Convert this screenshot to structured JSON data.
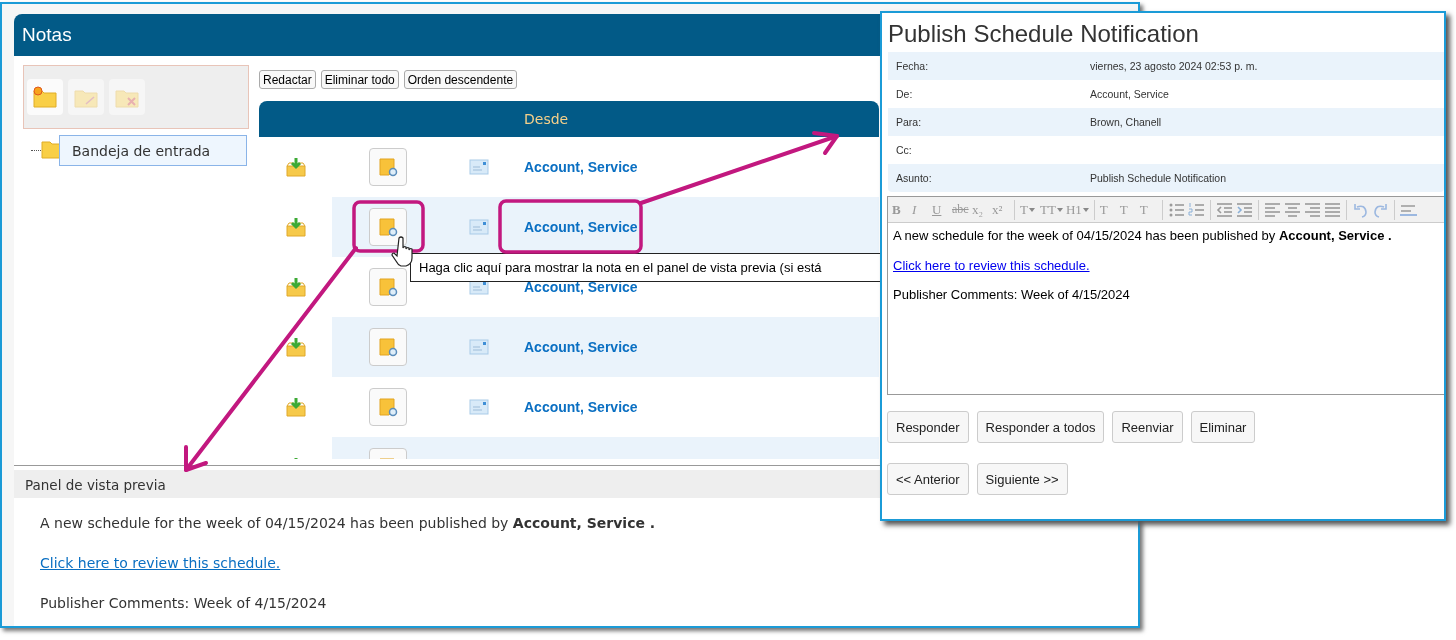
{
  "notes_window": {
    "title": "Notas",
    "folder_toolbar": [
      {
        "kind": "new-folder",
        "disabled": false
      },
      {
        "kind": "rename-folder",
        "disabled": true
      },
      {
        "kind": "delete-folder",
        "disabled": true
      }
    ],
    "folders": [
      {
        "label": "Bandeja de entrada",
        "selected": true
      }
    ],
    "actions": [
      "Redactar",
      "Eliminar todo",
      "Orden descendente"
    ],
    "table": {
      "header": "Desde",
      "rows": [
        {
          "from": "Account, Service"
        },
        {
          "from": "Account, Service"
        },
        {
          "from": "Account, Service"
        },
        {
          "from": "Account, Service"
        },
        {
          "from": "Account, Service"
        },
        {}
      ]
    },
    "tooltip": "Haga clic aquí para mostrar la nota en el panel de vista previa (si está",
    "preview": {
      "title": "Panel de vista previa",
      "body": [
        {
          "kind": "text",
          "text": "A new schedule for the week of 04/15/2024 has been published by **Account, Service .**"
        },
        {
          "kind": "link",
          "text": "Click here to review this schedule."
        },
        {
          "kind": "text",
          "text": "Publisher Comments: Week of 4/15/2024"
        }
      ]
    }
  },
  "message_window": {
    "title": "Publish Schedule Notification",
    "fields": [
      {
        "label": "Fecha:",
        "value": "viernes, 23 agosto 2024 02:53 p. m."
      },
      {
        "label": "De:",
        "value": "Account, Service"
      },
      {
        "label": "Para:",
        "value": "Brown, Chanell"
      },
      {
        "label": "Cc:"
      },
      {
        "label": "Asunto:",
        "value": "Publish Schedule Notification"
      }
    ],
    "editor": {
      "toolbar": [
        {
          "kind": "bold",
          "label": "B"
        },
        {
          "kind": "italic",
          "label": "I"
        },
        {
          "kind": "underline",
          "label": "U"
        },
        {
          "kind": "strike",
          "label": "abc"
        },
        {
          "kind": "plain",
          "label": "x₂"
        },
        {
          "kind": "plain",
          "label": "x²"
        },
        {
          "kind": "separator"
        },
        {
          "kind": "dropdown",
          "label": "T"
        },
        {
          "kind": "dropdown",
          "label": "TT"
        },
        {
          "kind": "dropdown",
          "label": "H1"
        },
        {
          "kind": "separator"
        },
        {
          "kind": "plain",
          "label": "T"
        },
        {
          "kind": "plain",
          "label": "T"
        },
        {
          "kind": "plain",
          "label": "T"
        },
        {
          "kind": "separator"
        },
        {
          "kind": "bullets"
        },
        {
          "kind": "numbers"
        },
        {
          "kind": "separator"
        },
        {
          "kind": "outdent"
        },
        {
          "kind": "indent"
        },
        {
          "kind": "separator"
        },
        {
          "kind": "align-left"
        },
        {
          "kind": "align-center"
        },
        {
          "kind": "align-right"
        },
        {
          "kind": "justify"
        },
        {
          "kind": "separator"
        },
        {
          "kind": "undo"
        },
        {
          "kind": "redo"
        },
        {
          "kind": "separator"
        },
        {
          "kind": "rule"
        }
      ],
      "body": [
        {
          "kind": "text",
          "text": "A new schedule for the week of 04/15/2024 has been published by **Account, Service .**"
        },
        {
          "kind": "link",
          "text": "Click here to review this schedule."
        },
        {
          "kind": "text",
          "text": "Publisher Comments: Week of 4/15/2024"
        }
      ]
    },
    "buttons": [
      "Responder",
      "Responder a todos",
      "Reenviar",
      "Eliminar"
    ],
    "nav_buttons": [
      "<< Anterior",
      "Siguiente >>"
    ]
  }
}
